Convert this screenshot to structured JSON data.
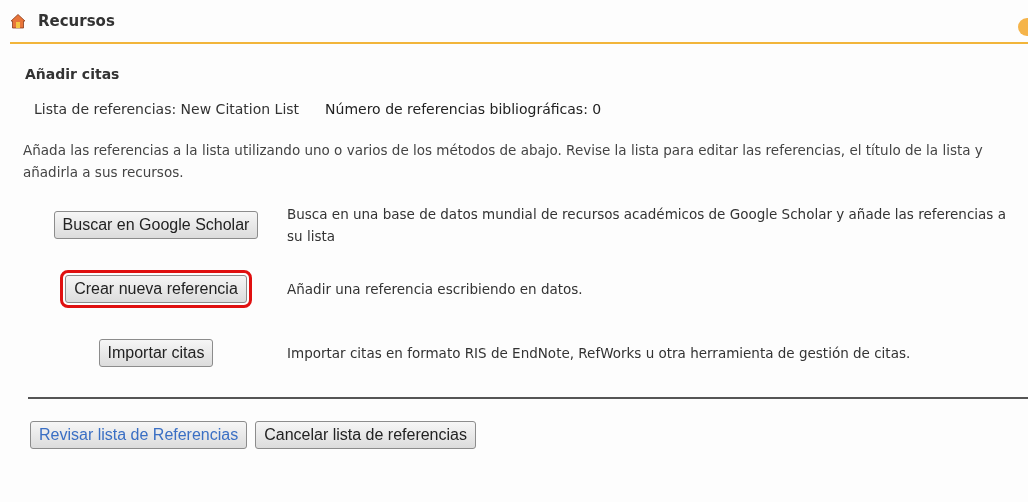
{
  "header": {
    "title": "Recursos"
  },
  "section_title": "Añadir citas",
  "list_info": {
    "list_label": "Lista de referencias: New Citation List",
    "count_label": "Número de referencias bibliográficas: 0"
  },
  "intro": "Añada las referencias a la lista utilizando uno o varios de los métodos de abajo. Revise la lista para editar las referencias, el título de la lista y añadirla a sus recursos.",
  "methods": [
    {
      "button": "Buscar en Google Scholar",
      "description": "Busca en una base de datos mundial de recursos académicos de Google Scholar y añade las referencias a su lista",
      "highlighted": false
    },
    {
      "button": "Crear nueva referencia",
      "description": "Añadir una referencia escribiendo en datos.",
      "highlighted": true
    },
    {
      "button": "Importar citas",
      "description": "Importar citas en formato RIS de EndNote, RefWorks u otra herramienta de gestión de citas.",
      "highlighted": false
    }
  ],
  "actions": [
    {
      "label": "Revisar lista de Referencias",
      "focused": true
    },
    {
      "label": "Cancelar lista de referencias",
      "focused": false
    }
  ]
}
